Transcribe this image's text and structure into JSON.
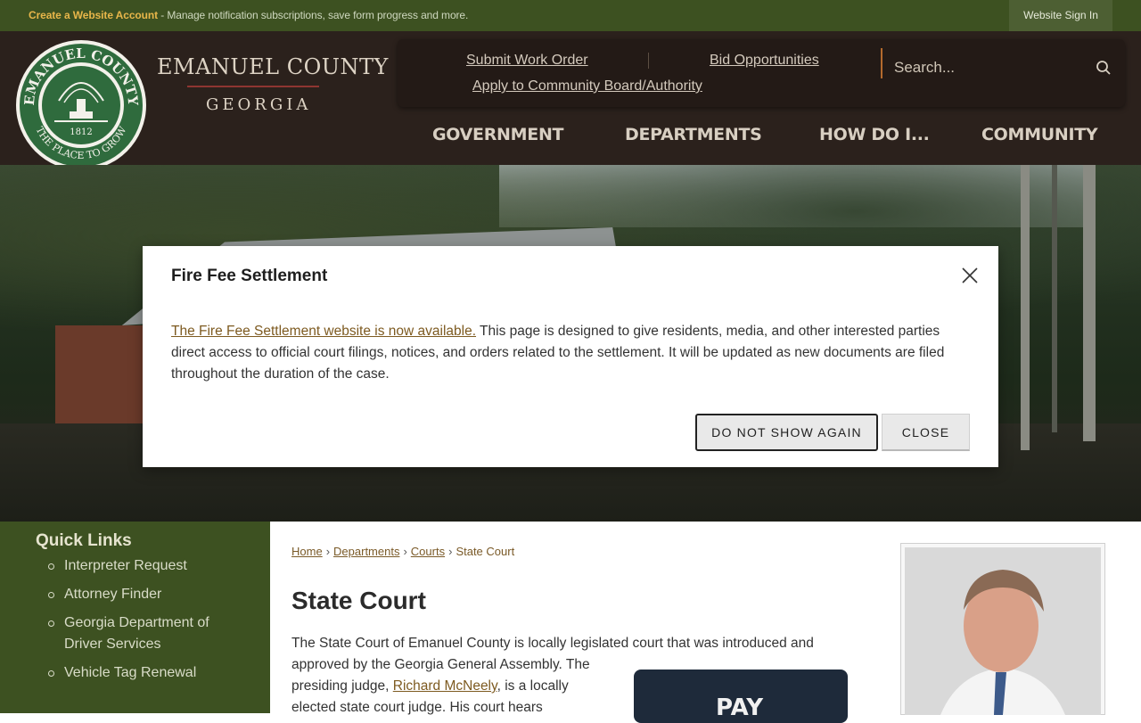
{
  "topbar": {
    "create_link": "Create a Website Account",
    "message": " - Manage notification subscriptions, save form progress and more.",
    "sign_in": "Website Sign In"
  },
  "brand": {
    "name": "EMANUEL COUNTY",
    "state": "GEORGIA",
    "seal_top_text": "EMANUEL COUNTY",
    "seal_bottom_text": "THE PLACE TO GROW",
    "seal_year": "1812"
  },
  "utility_nav": {
    "submit_work_order": "Submit Work Order",
    "bid_opportunities": "Bid Opportunities",
    "apply_board": "Apply to Community Board/Authority"
  },
  "search": {
    "placeholder": "Search..."
  },
  "main_nav": [
    "GOVERNMENT",
    "DEPARTMENTS",
    "HOW DO I...",
    "COMMUNITY"
  ],
  "modal": {
    "title": "Fire Fee Settlement",
    "link_text": "The Fire Fee Settlement website is now available.",
    "body": " This page is designed to give residents, media, and other interested parties direct access to official court filings, notices, and orders related to the settlement. It will be updated as new documents are filed throughout the duration of the case.",
    "dont_show_label": "DO NOT SHOW AGAIN",
    "close_label": "CLOSE"
  },
  "quick_links": {
    "title": "Quick Links",
    "items": [
      "Interpreter Request",
      "Attorney Finder",
      "Georgia Department of Driver Services",
      "Vehicle Tag Renewal"
    ]
  },
  "breadcrumb": [
    "Home",
    "Departments",
    "Courts",
    "State Court"
  ],
  "page": {
    "title": "State Court",
    "para1": "The State Court of Emanuel County is locally legislated court that was introduced and",
    "para2_a": "approved by the Georgia General Assembly. The presiding judge, ",
    "judge_link": "Richard McNeely",
    "para2_b": ", is a locally elected state court judge. His court hears",
    "pay_text": "PAY"
  },
  "colors": {
    "topbar": "#3d5121",
    "header": "#2b211c",
    "accent_gold": "#e8b64a",
    "link_brown": "#7d5a20",
    "sidebar": "#3d5121"
  }
}
